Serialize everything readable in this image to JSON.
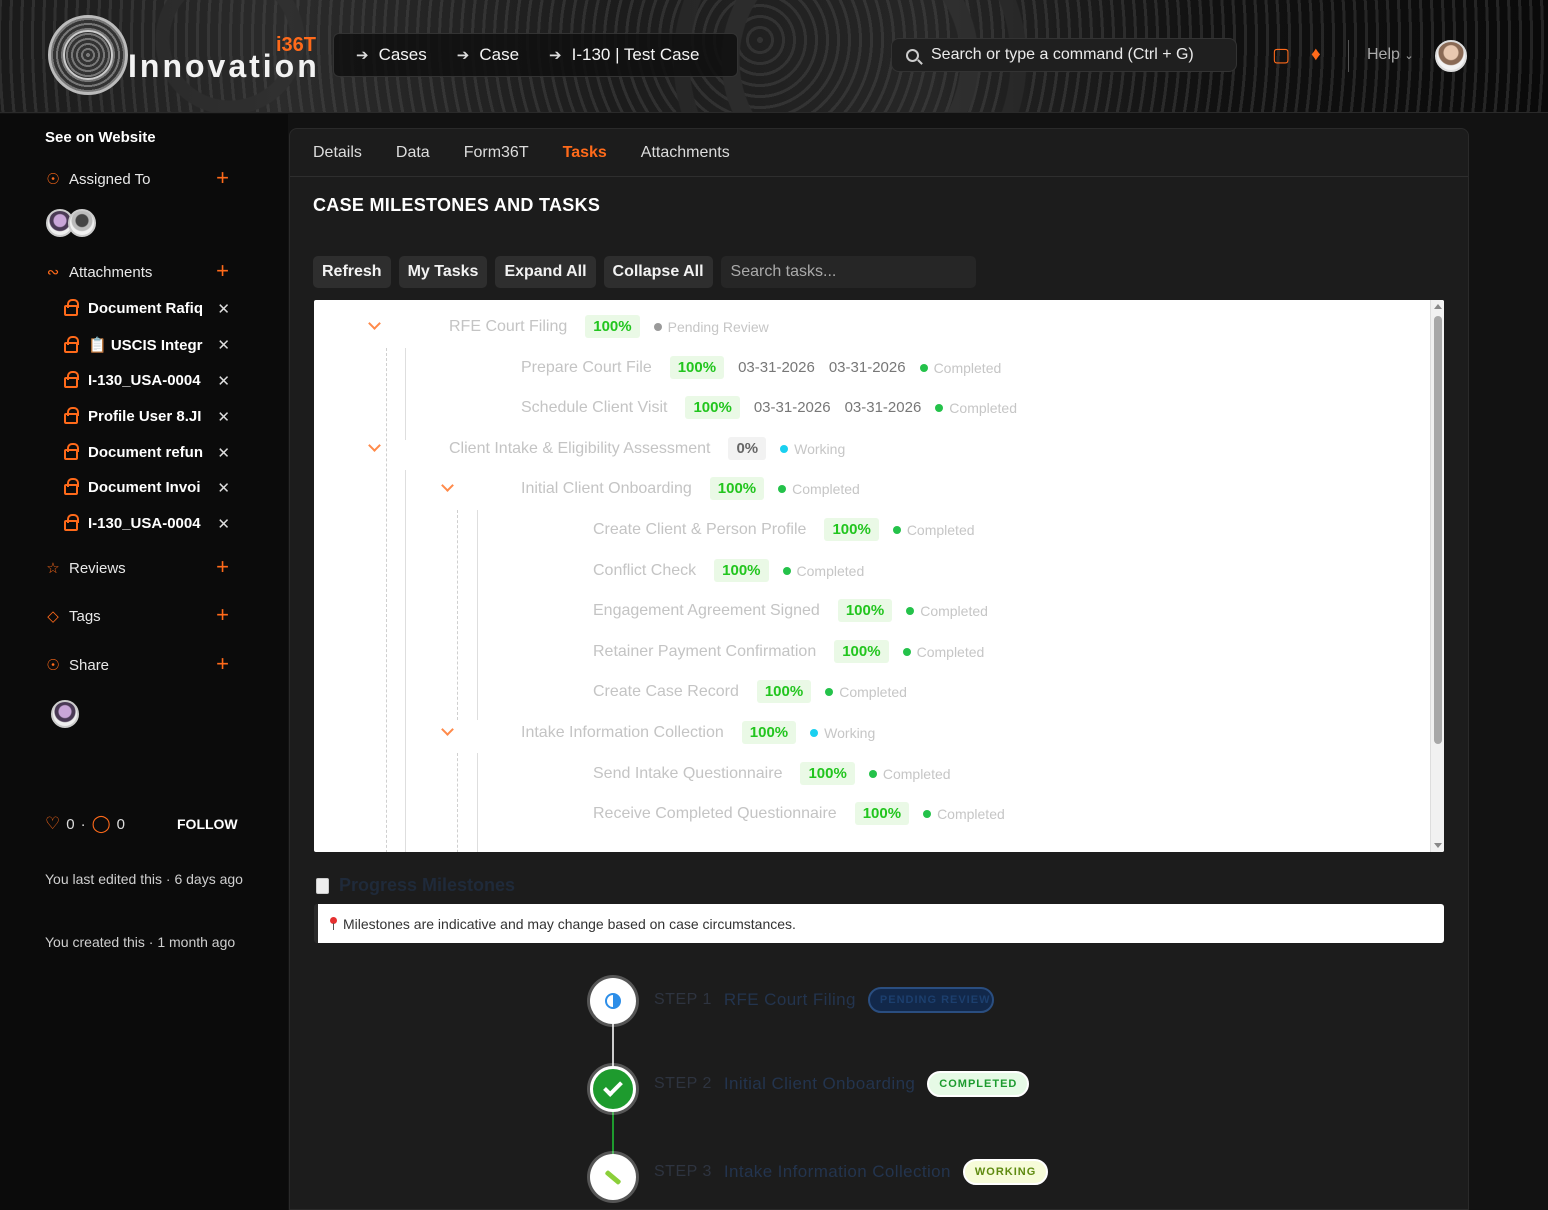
{
  "header": {
    "brand": "Innovation",
    "brand_tag": "i36T",
    "breadcrumbs": [
      "Cases",
      "Case",
      "I-130 | Test Case"
    ],
    "search_placeholder": "Search or type a command (Ctrl + G)",
    "help_label": "Help"
  },
  "sidebar": {
    "see_on_website": "See on Website",
    "assigned_to": "Assigned To",
    "attachments_label": "Attachments",
    "attachments": [
      "Document Rafiq",
      "📋 USCIS Integr",
      "I-130_USA-0004",
      "Profile User 8.JI",
      "Document refun",
      "Document Invoi",
      "I-130_USA-0004"
    ],
    "reviews": "Reviews",
    "tags": "Tags",
    "share": "Share",
    "likes": "0",
    "separator": "·",
    "comments": "0",
    "follow": "FOLLOW",
    "last_edited": "You last edited this · 6 days ago",
    "created": "You created this · 1 month ago"
  },
  "tabs": [
    "Details",
    "Data",
    "Form36T",
    "Tasks",
    "Attachments"
  ],
  "active_tab": "Tasks",
  "section_title": "CASE MILESTONES AND TASKS",
  "toolbar": {
    "refresh": "Refresh",
    "my_tasks": "My Tasks",
    "expand_all": "Expand All",
    "collapse_all": "Collapse All",
    "search_placeholder": "Search tasks..."
  },
  "tasks": [
    {
      "level": 0,
      "name": "RFE Court Filing",
      "pct": "100%",
      "status": "Pending Review",
      "state": "pending",
      "expandable": true
    },
    {
      "level": 1,
      "name": "Prepare Court File",
      "pct": "100%",
      "start": "03-31-2026",
      "end": "03-31-2026",
      "status": "Completed",
      "state": "completed"
    },
    {
      "level": 1,
      "name": "Schedule Client Visit",
      "pct": "100%",
      "start": "03-31-2026",
      "end": "03-31-2026",
      "status": "Completed",
      "state": "completed"
    },
    {
      "level": 0,
      "name": "Client Intake & Eligibility Assessment",
      "pct": "0%",
      "status": "Working",
      "state": "working",
      "expandable": true
    },
    {
      "level": 1,
      "name": "Initial Client Onboarding",
      "pct": "100%",
      "status": "Completed",
      "state": "completed",
      "expandable": true
    },
    {
      "level": 2,
      "name": "Create Client & Person Profile",
      "pct": "100%",
      "status": "Completed",
      "state": "completed"
    },
    {
      "level": 2,
      "name": "Conflict Check",
      "pct": "100%",
      "status": "Completed",
      "state": "completed"
    },
    {
      "level": 2,
      "name": "Engagement Agreement Signed",
      "pct": "100%",
      "status": "Completed",
      "state": "completed"
    },
    {
      "level": 2,
      "name": "Retainer Payment Confirmation",
      "pct": "100%",
      "status": "Completed",
      "state": "completed"
    },
    {
      "level": 2,
      "name": "Create Case Record",
      "pct": "100%",
      "status": "Completed",
      "state": "completed"
    },
    {
      "level": 1,
      "name": "Intake Information Collection",
      "pct": "100%",
      "status": "Working",
      "state": "working",
      "expandable": true
    },
    {
      "level": 2,
      "name": "Send Intake Questionnaire",
      "pct": "100%",
      "status": "Completed",
      "state": "completed"
    },
    {
      "level": 2,
      "name": "Receive Completed Questionnaire",
      "pct": "100%",
      "status": "Completed",
      "state": "completed"
    }
  ],
  "progress": {
    "title": "Progress Milestones",
    "notice": "Milestones are indicative and may change based on case circumstances.",
    "steps": [
      {
        "label": "STEP 1",
        "name": "RFE Court Filing",
        "badge": "PENDING REVIEW",
        "state": "pending"
      },
      {
        "label": "STEP 2",
        "name": "Initial Client Onboarding",
        "badge": "COMPLETED",
        "state": "completed"
      },
      {
        "label": "STEP 3",
        "name": "Intake Information Collection",
        "badge": "WORKING",
        "state": "working"
      }
    ]
  },
  "colors": {
    "accent": "#ff6a1a",
    "completed": "#24c24a",
    "working": "#1ad0f0",
    "pending": "#9a9a9a"
  }
}
